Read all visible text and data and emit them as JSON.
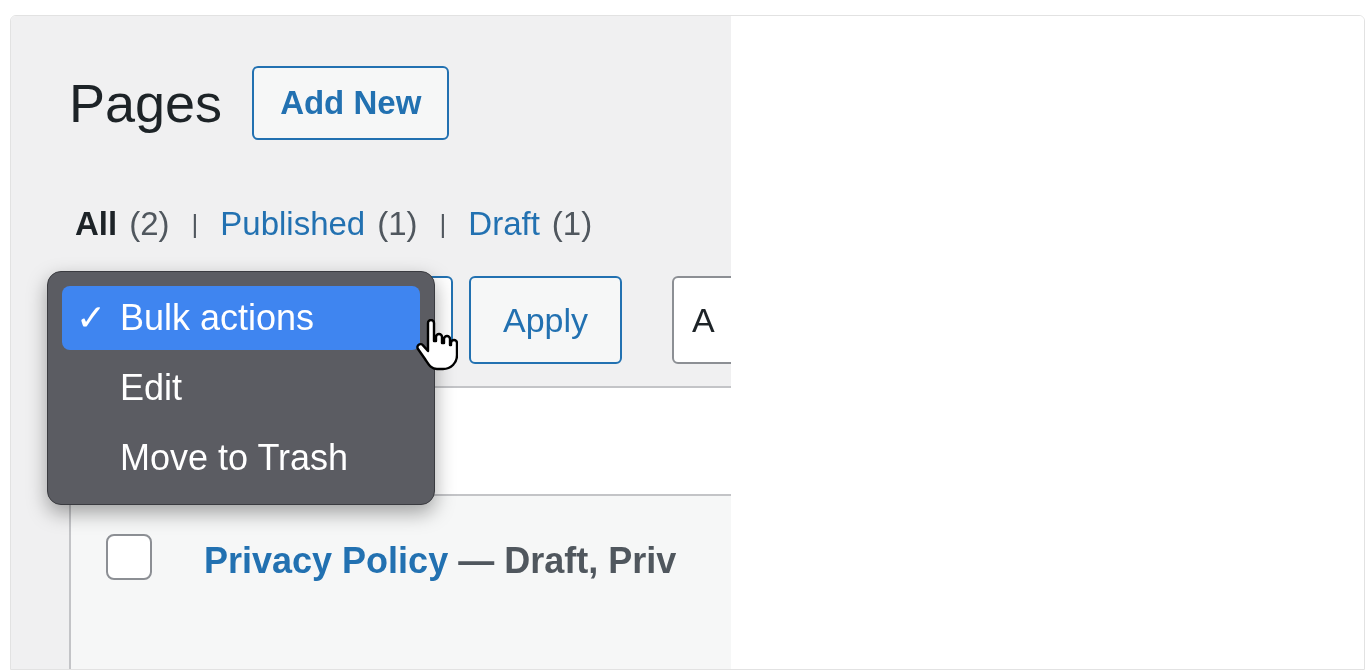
{
  "title": "Pages",
  "add_new": "Add New",
  "filters": [
    {
      "label": "All",
      "count": "(2)",
      "selected": true
    },
    {
      "separator": "|",
      "label": "Published",
      "count": "(1)",
      "selected": false
    },
    {
      "separator": "|",
      "label": "Draft",
      "count": "(1)",
      "selected": false
    }
  ],
  "bulk_menu": {
    "check_mark": "✓",
    "items": [
      {
        "label": "Bulk actions",
        "selected": true
      },
      {
        "label": "Edit",
        "selected": false
      },
      {
        "label": "Move to Trash",
        "selected": false
      }
    ]
  },
  "apply": "Apply",
  "next_control": "A",
  "rows": [
    {
      "title": "Privacy Policy",
      "states": "— Draft, Priv",
      "checked": false
    }
  ]
}
